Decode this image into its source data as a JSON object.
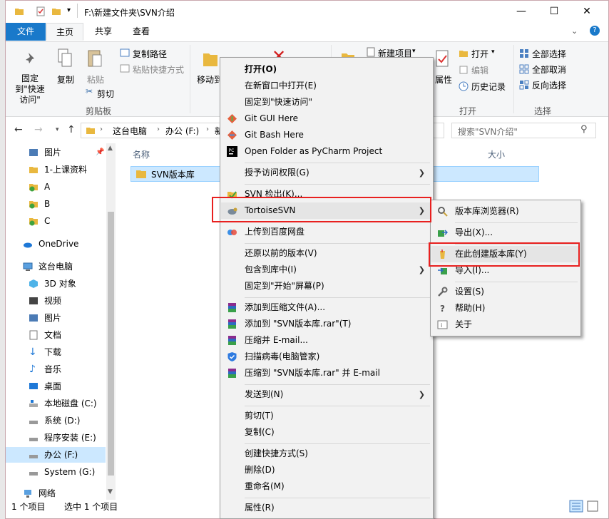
{
  "window": {
    "title": "F:\\新建文件夹\\SVN介绍",
    "controls": {
      "minimize": "—",
      "maximize": "☐",
      "close": "✕"
    }
  },
  "ribbon": {
    "tabs": [
      "文件",
      "主页",
      "共享",
      "查看"
    ],
    "pin": "固定到\"快速访问\"",
    "copy": "复制",
    "paste": "粘贴",
    "copy_path": "复制路径",
    "paste_shortcut": "粘贴快捷方式",
    "cut": "剪切",
    "group_clipboard": "剪贴板",
    "move_to": "移动到",
    "new_item": "新建项目",
    "open": "打开",
    "edit": "编辑",
    "history": "历史记录",
    "properties": "属性",
    "group_open": "打开",
    "select_all": "全部选择",
    "select_none": "全部取消",
    "invert": "反向选择",
    "group_select": "选择"
  },
  "address": {
    "crumbs": [
      "这台电脑",
      "办公 (F:)",
      "新"
    ],
    "search_placeholder": "搜索\"SVN介绍\""
  },
  "nav": {
    "items": [
      {
        "label": "图片"
      },
      {
        "label": "1-上课资料"
      },
      {
        "label": "A"
      },
      {
        "label": "B"
      },
      {
        "label": "C"
      },
      {
        "label": "OneDrive"
      },
      {
        "label": "这台电脑"
      },
      {
        "label": "3D 对象"
      },
      {
        "label": "视频"
      },
      {
        "label": "图片"
      },
      {
        "label": "文档"
      },
      {
        "label": "下载"
      },
      {
        "label": "音乐"
      },
      {
        "label": "桌面"
      },
      {
        "label": "本地磁盘 (C:)"
      },
      {
        "label": "系统 (D:)"
      },
      {
        "label": "程序安装 (E:)"
      },
      {
        "label": "办公 (F:)"
      },
      {
        "label": "System (G:)"
      },
      {
        "label": "网络"
      }
    ]
  },
  "content": {
    "col_name": "名称",
    "col_size": "大小",
    "file": "SVN版本库"
  },
  "status": {
    "count": "1 个项目",
    "selected": "选中 1 个项目"
  },
  "context_menu": {
    "items": [
      "打开(O)",
      "在新窗口中打开(E)",
      "固定到\"快速访问\"",
      "Git GUI Here",
      "Git Bash Here",
      "Open Folder as PyCharm Project",
      "授予访问权限(G)",
      "SVN 检出(K)...",
      "TortoiseSVN",
      "上传到百度网盘",
      "还原以前的版本(V)",
      "包含到库中(I)",
      "固定到\"开始\"屏幕(P)",
      "添加到压缩文件(A)...",
      "添加到 \"SVN版本库.rar\"(T)",
      "压缩并 E-mail...",
      "扫描病毒(电脑管家)",
      "压缩到 \"SVN版本库.rar\" 并 E-mail",
      "发送到(N)",
      "剪切(T)",
      "复制(C)",
      "创建快捷方式(S)",
      "删除(D)",
      "重命名(M)",
      "属性(R)"
    ]
  },
  "submenu": {
    "items": [
      "版本库浏览器(R)",
      "导出(X)...",
      "在此创建版本库(Y)",
      "导入(I)...",
      "设置(S)",
      "帮助(H)",
      "关于"
    ]
  },
  "colors": {
    "accent": "#1979ca",
    "highlight_box": "#e8201f",
    "selection": "#cce8ff"
  }
}
